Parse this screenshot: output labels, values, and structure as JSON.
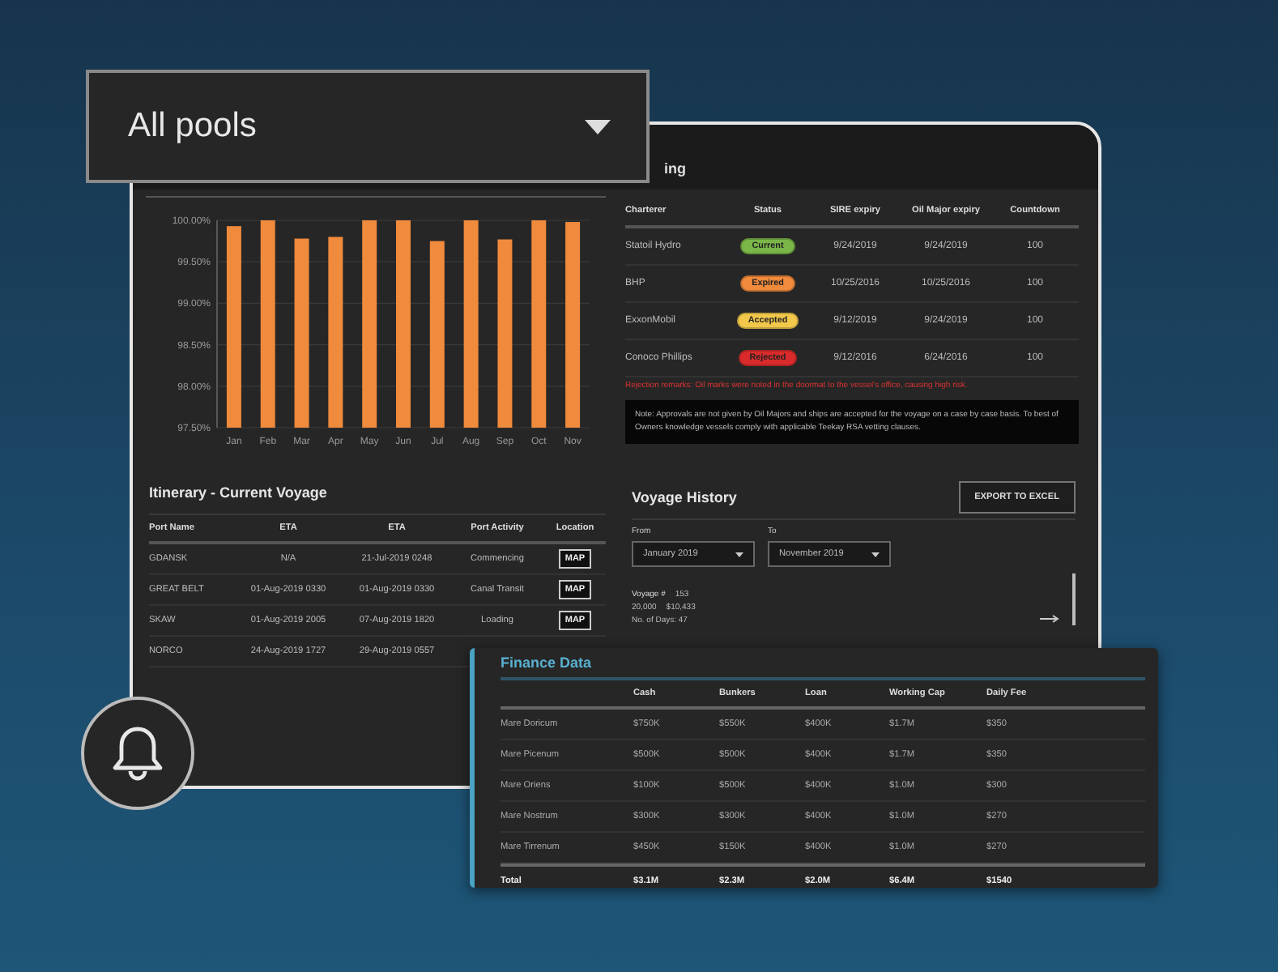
{
  "pool_selector": {
    "value": "All pools"
  },
  "uptime_chart": {
    "chart_data": {
      "type": "bar",
      "categories": [
        "Jan",
        "Feb",
        "Mar",
        "Apr",
        "May",
        "Jun",
        "Jul",
        "Aug",
        "Sep",
        "Oct",
        "Nov"
      ],
      "grid": true,
      "series": [
        {
          "color": "#f08a3c",
          "values": [
            99.93,
            100,
            99.78,
            99.8,
            100,
            100,
            99.75,
            100,
            99.77,
            100,
            99.98
          ]
        }
      ],
      "ylim": [
        97.5,
        100
      ],
      "yticks": [
        {
          "value": 97.5,
          "label": "97.50%"
        },
        {
          "value": 98,
          "label": "98.00%"
        },
        {
          "value": 98.5,
          "label": "98.50%"
        },
        {
          "value": 99,
          "label": "99.00%"
        },
        {
          "value": 99.5,
          "label": "99.50%"
        },
        {
          "value": 100,
          "label": "100.00%"
        }
      ]
    }
  },
  "vetting": {
    "title": "ing",
    "columns": [
      "Charterer",
      "Status",
      "SIRE expiry",
      "Oil Major expiry",
      "Countdown"
    ],
    "rows": [
      {
        "charterer": "Statoil Hydro",
        "status": "Current",
        "color": "#7ab648",
        "sire_expiry": "9/24/2019",
        "oil_major_expiry": "9/24/2019",
        "countdown": "100"
      },
      {
        "charterer": "BHP",
        "status": "Expired",
        "color": "#f08a3c",
        "sire_expiry": "10/25/2016",
        "oil_major_expiry": "10/25/2016",
        "countdown": "100"
      },
      {
        "charterer": "ExxonMobil",
        "status": "Accepted",
        "color": "#f2c84b",
        "sire_expiry": "9/12/2019",
        "oil_major_expiry": "9/24/2019",
        "countdown": "100"
      },
      {
        "charterer": "Conoco Phillips",
        "status": "Rejected",
        "color": "#d92b2b",
        "sire_expiry": "9/12/2016",
        "oil_major_expiry": "6/24/2016",
        "countdown": "100"
      }
    ],
    "remark": "Rejection remarks: Oil marks were noted in the doormat to the vessel's office, causing high risk.",
    "note": "Note: Approvals are not given by Oil Majors and ships are accepted for the voyage on a case by case basis. To best of Owners knowledge vessels comply with applicable Teekay RSA vetting clauses."
  },
  "itinerary": {
    "title": "Itinerary - Current Voyage",
    "columns": [
      "Port Name",
      "ETA",
      "ETA",
      "Port Activity",
      "Location"
    ],
    "rows": [
      {
        "port": "GDANSK",
        "eta_1": "N/A",
        "eta_2": "21-Jul-2019 0248",
        "activity": "Commencing",
        "location": "MAP"
      },
      {
        "port": "GREAT BELT",
        "eta_1": "01-Aug-2019 0330",
        "eta_2": "01-Aug-2019 0330",
        "activity": "Canal Transit",
        "location": "MAP"
      },
      {
        "port": "SKAW",
        "eta_1": "01-Aug-2019 2005",
        "eta_2": "07-Aug-2019 1820",
        "activity": "Loading",
        "location": "MAP"
      },
      {
        "port": "NORCO",
        "eta_1": "24-Aug-2019 1727",
        "eta_2": "29-Aug-2019 0557"
      }
    ]
  },
  "voyage_history": {
    "title": "Voyage History",
    "export_button": "EXPORT TO EXCEL",
    "from_label": "From",
    "from_value": "January 2019",
    "to_label": "To",
    "to_value": "November 2019",
    "voyage_label": "Voyage #",
    "voyage_number": "153",
    "amount_1": "20,000",
    "amount_2": "$10,433",
    "days": "No. of Days: 47"
  },
  "finance": {
    "title": "Finance Data",
    "columns": [
      "Cash",
      "Bunkers",
      "Loan",
      "Working Cap",
      "Daily Fee"
    ],
    "rows": [
      {
        "name": "Mare Doricum",
        "values": [
          "$750K",
          "$550K",
          "$400K",
          "$1.7M",
          "$350"
        ]
      },
      {
        "name": "Mare Picenum",
        "values": [
          "$500K",
          "$500K",
          "$400K",
          "$1.7M",
          "$350"
        ]
      },
      {
        "name": "Mare Oriens",
        "values": [
          "$100K",
          "$500K",
          "$400K",
          "$1.0M",
          "$300"
        ]
      },
      {
        "name": "Mare Nostrum",
        "values": [
          "$300K",
          "$300K",
          "$400K",
          "$1.0M",
          "$270"
        ]
      },
      {
        "name": "Mare Tirrenum",
        "values": [
          "$450K",
          "$150K",
          "$400K",
          "$1.0M",
          "$270"
        ]
      }
    ],
    "total": {
      "label": "Total",
      "values": [
        "$3.1M",
        "$2.3M",
        "$2.0M",
        "$6.4M",
        "$1540"
      ]
    }
  }
}
